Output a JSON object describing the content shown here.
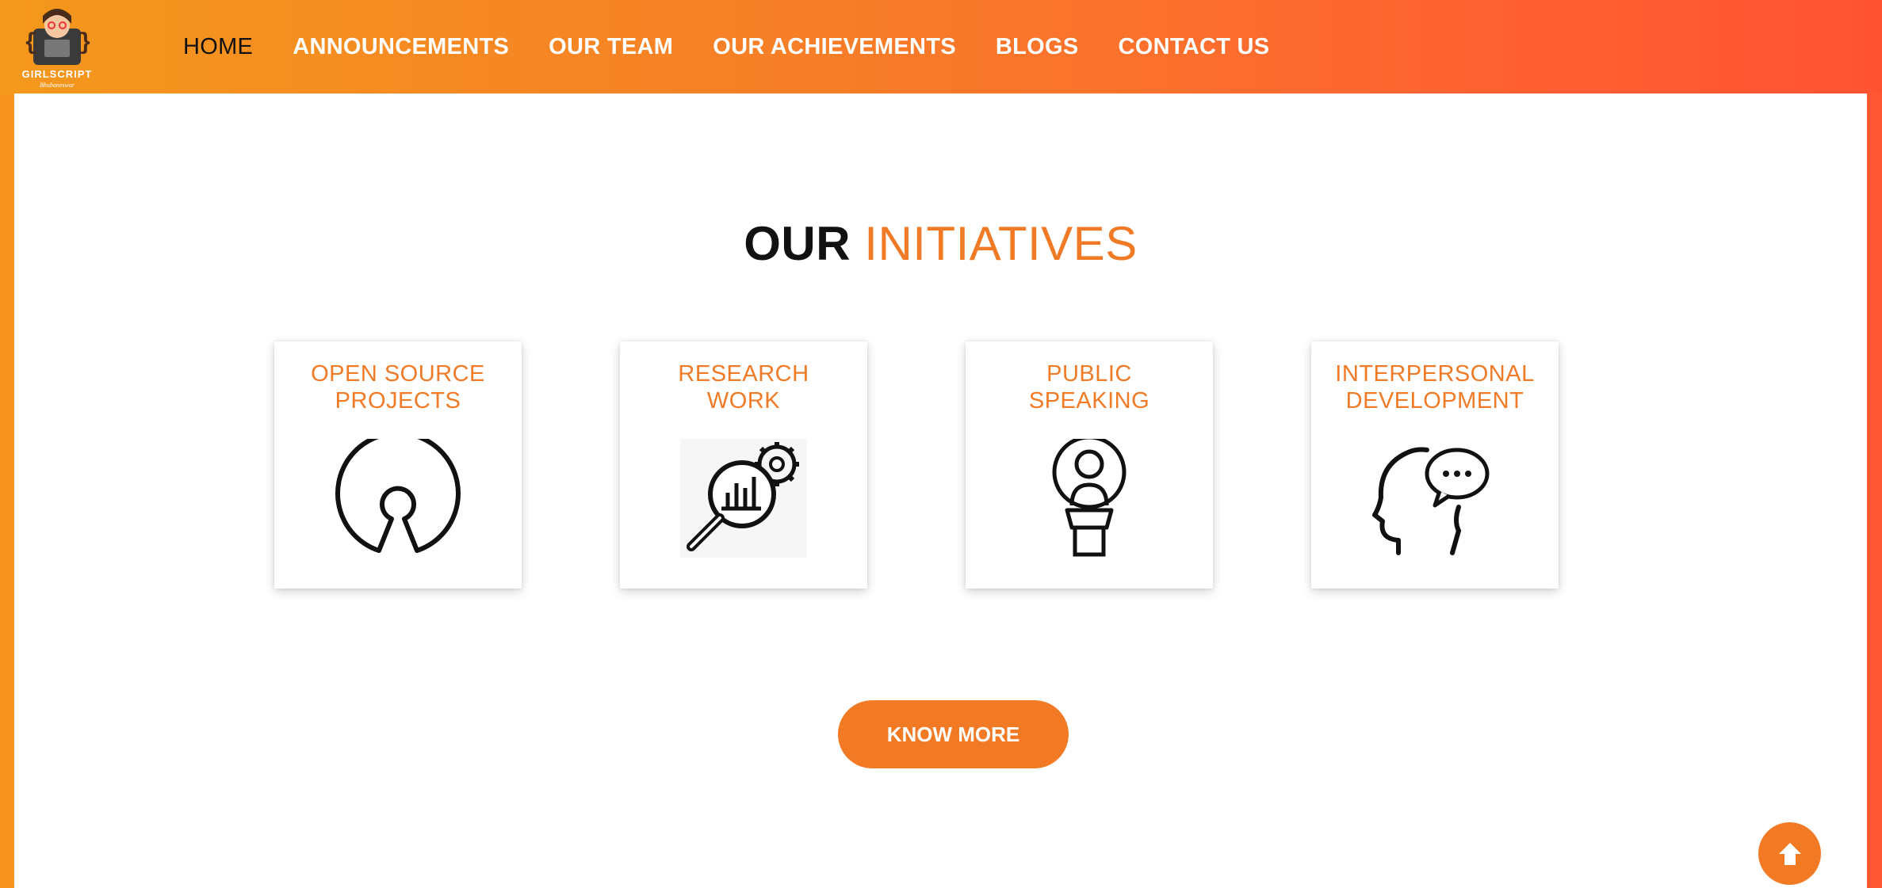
{
  "nav": {
    "logo_text": "GIRLSCRIPT",
    "logo_subtext": "Bhubaneswar",
    "links": [
      "HOME",
      "ANNOUNCEMENTS",
      "OUR TEAM",
      "OUR ACHIEVEMENTS",
      "BLOGS",
      "CONTACT US"
    ],
    "active": "HOME"
  },
  "initiatives": {
    "title_bold": "OUR",
    "title_light": "INITIATIVES",
    "cards": [
      {
        "title": "OPEN SOURCE\nPROJECTS",
        "icon": "open-source-icon"
      },
      {
        "title": "RESEARCH\nWORK",
        "icon": "research-icon"
      },
      {
        "title": "PUBLIC\nSPEAKING",
        "icon": "public-speaking-icon"
      },
      {
        "title": "INTERPERSONAL\nDEVELOPMENT",
        "icon": "interpersonal-icon"
      }
    ],
    "button_label": "KNOW MORE"
  },
  "colors": {
    "accent": "#f07a26",
    "nav_gradient_start": "#f4981c",
    "nav_gradient_end": "#ff5233"
  }
}
